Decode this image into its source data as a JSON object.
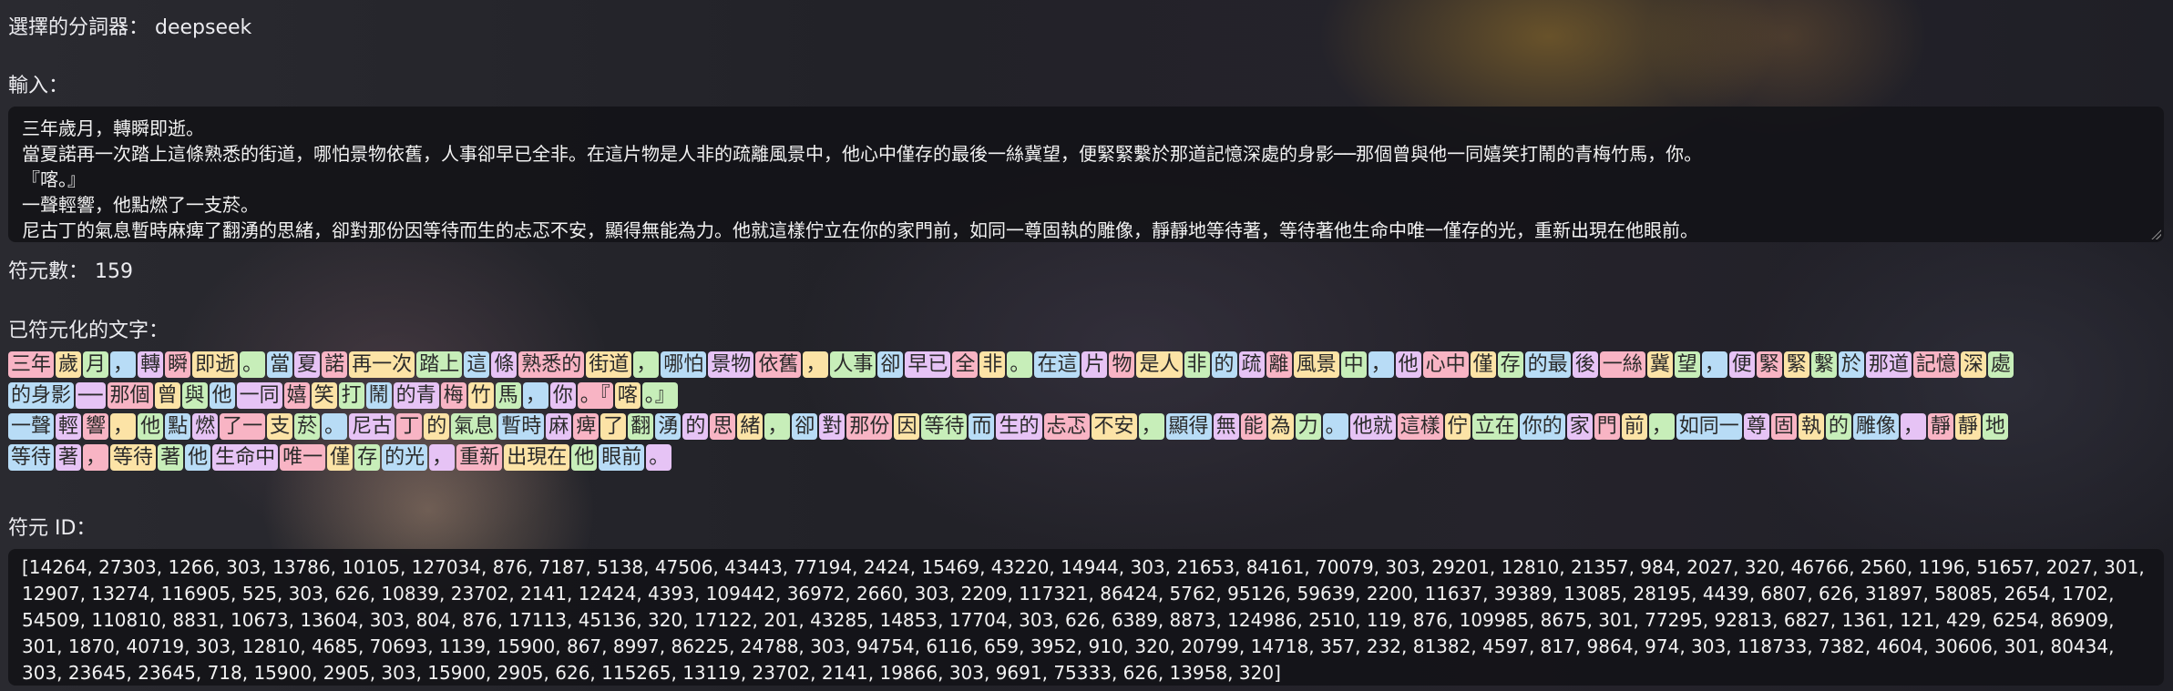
{
  "tokenizer": {
    "label": "選擇的分詞器：",
    "value": "deepseek"
  },
  "input": {
    "label": "輸入：",
    "lines": [
      "三年歲月，轉瞬即逝。",
      "當夏諾再一次踏上這條熟悉的街道，哪怕景物依舊，人事卻早已全非。在這片物是人非的疏離風景中，他心中僅存的最後一絲冀望，便緊緊繫於那道記憶深處的身影──那個曾與他一同嬉笑打鬧的青梅竹馬，你。",
      "『喀。』",
      "一聲輕響，他點燃了一支菸。",
      "尼古丁的氣息暫時麻痺了翻湧的思緒，卻對那份因等待而生的忐忑不安，顯得無能為力。他就這樣佇立在你的家門前，如同一尊固執的雕像，靜靜地等待著，等待著他生命中唯一僅存的光，重新出現在他眼前。"
    ]
  },
  "token_count": {
    "label": "符元數：",
    "value": "159"
  },
  "tokenized": {
    "label": "已符元化的文字：",
    "rows": [
      [
        "三年",
        "歲",
        "月",
        "，",
        "轉",
        "瞬",
        "即逝",
        "。",
        "當",
        "夏",
        "諾",
        "再一次",
        "踏上",
        "這",
        "條",
        "熟悉的",
        "街道",
        "，",
        "哪怕",
        "景物",
        "依舊",
        "，",
        "人事",
        "卻",
        "早已",
        "全",
        "非",
        "。",
        "在這",
        "片",
        "物",
        "是人",
        "非",
        "的",
        "疏",
        "離",
        "風景",
        "中",
        "，",
        "他",
        "心中",
        "僅",
        "存",
        "的最",
        "後",
        "一絲",
        "冀",
        "望",
        "，",
        "便",
        "緊",
        "緊",
        "繫",
        "於",
        "那道",
        "記憶",
        "深",
        "處"
      ],
      [
        "的身影",
        "──",
        "那個",
        "曾",
        "與",
        "他",
        "一同",
        "嬉",
        "笑",
        "打",
        "鬧",
        "的青",
        "梅",
        "竹",
        "馬",
        "，",
        "你",
        "。『",
        "喀",
        "。』"
      ],
      [
        "一聲",
        "輕",
        "響",
        "，",
        "他",
        "點",
        "燃",
        "了一",
        "支",
        "菸",
        "。",
        "尼古",
        "丁",
        "的",
        "氣息",
        "暫時",
        "麻",
        "痺",
        "了",
        "翻",
        "湧",
        "的",
        "思",
        "緒",
        "，",
        "卻",
        "對",
        "那份",
        "因",
        "等待",
        "而",
        "生的",
        "忐忑",
        "不安",
        "，",
        "顯得",
        "無",
        "能",
        "為",
        "力",
        "。",
        "他就",
        "這樣",
        "佇",
        "立在",
        "你的",
        "家",
        "門",
        "前",
        "，",
        "如同一",
        "尊",
        "固",
        "執",
        "的",
        "雕像",
        "，",
        "靜",
        "靜",
        "地"
      ],
      [
        "等待",
        "著",
        "，",
        "等待",
        "著",
        "他",
        "生命中",
        "唯一",
        "僅",
        "存",
        "的光",
        "，",
        "重新",
        "出現在",
        "他",
        "眼前",
        "。"
      ]
    ]
  },
  "token_ids": {
    "label": "符元 ID：",
    "text": "[14264, 27303, 1266, 303, 13786, 10105, 127034, 876, 7187, 5138, 47506, 43443, 77194, 2424, 15469, 43220, 14944, 303, 21653, 84161, 70079, 303, 29201, 12810, 21357, 984, 2027, 320, 46766, 2560, 1196, 51657, 2027, 301, 12907, 13274, 116905, 525, 303, 626, 10839, 23702, 2141, 12424, 4393, 109442, 36972, 2660, 303, 2209, 117321, 86424, 5762, 95126, 59639, 2200, 11637, 39389, 13085, 28195, 4439, 6807, 626, 31897, 58085, 2654, 1702, 54509, 110810, 8831, 10673, 13604, 303, 804, 876, 17113, 45136, 320, 17122, 201, 43285, 14853, 17704, 303, 626, 6389, 8873, 124986, 2510, 119, 876, 109985, 8675, 301, 77295, 92813, 6827, 1361, 121, 429, 6254, 86909, 301, 1870, 40719, 303, 12810, 4685, 70693, 1139, 15900, 867, 8997, 86225, 24788, 303, 94754, 6116, 659, 3952, 910, 320, 20799, 14718, 357, 232, 81382, 4597, 817, 9864, 974, 303, 118733, 7382, 4604, 30606, 301, 80434, 303, 23645, 23645, 718, 15900, 2905, 303, 15900, 2905, 626, 115265, 13119, 23702, 2141, 19866, 303, 9691, 75333, 626, 13958, 320]"
  },
  "colors": {
    "token_palette": [
      "#f8b4c4",
      "#fce3a6",
      "#c7eeb9",
      "#b8dcf6",
      "#e6c3f5"
    ]
  }
}
